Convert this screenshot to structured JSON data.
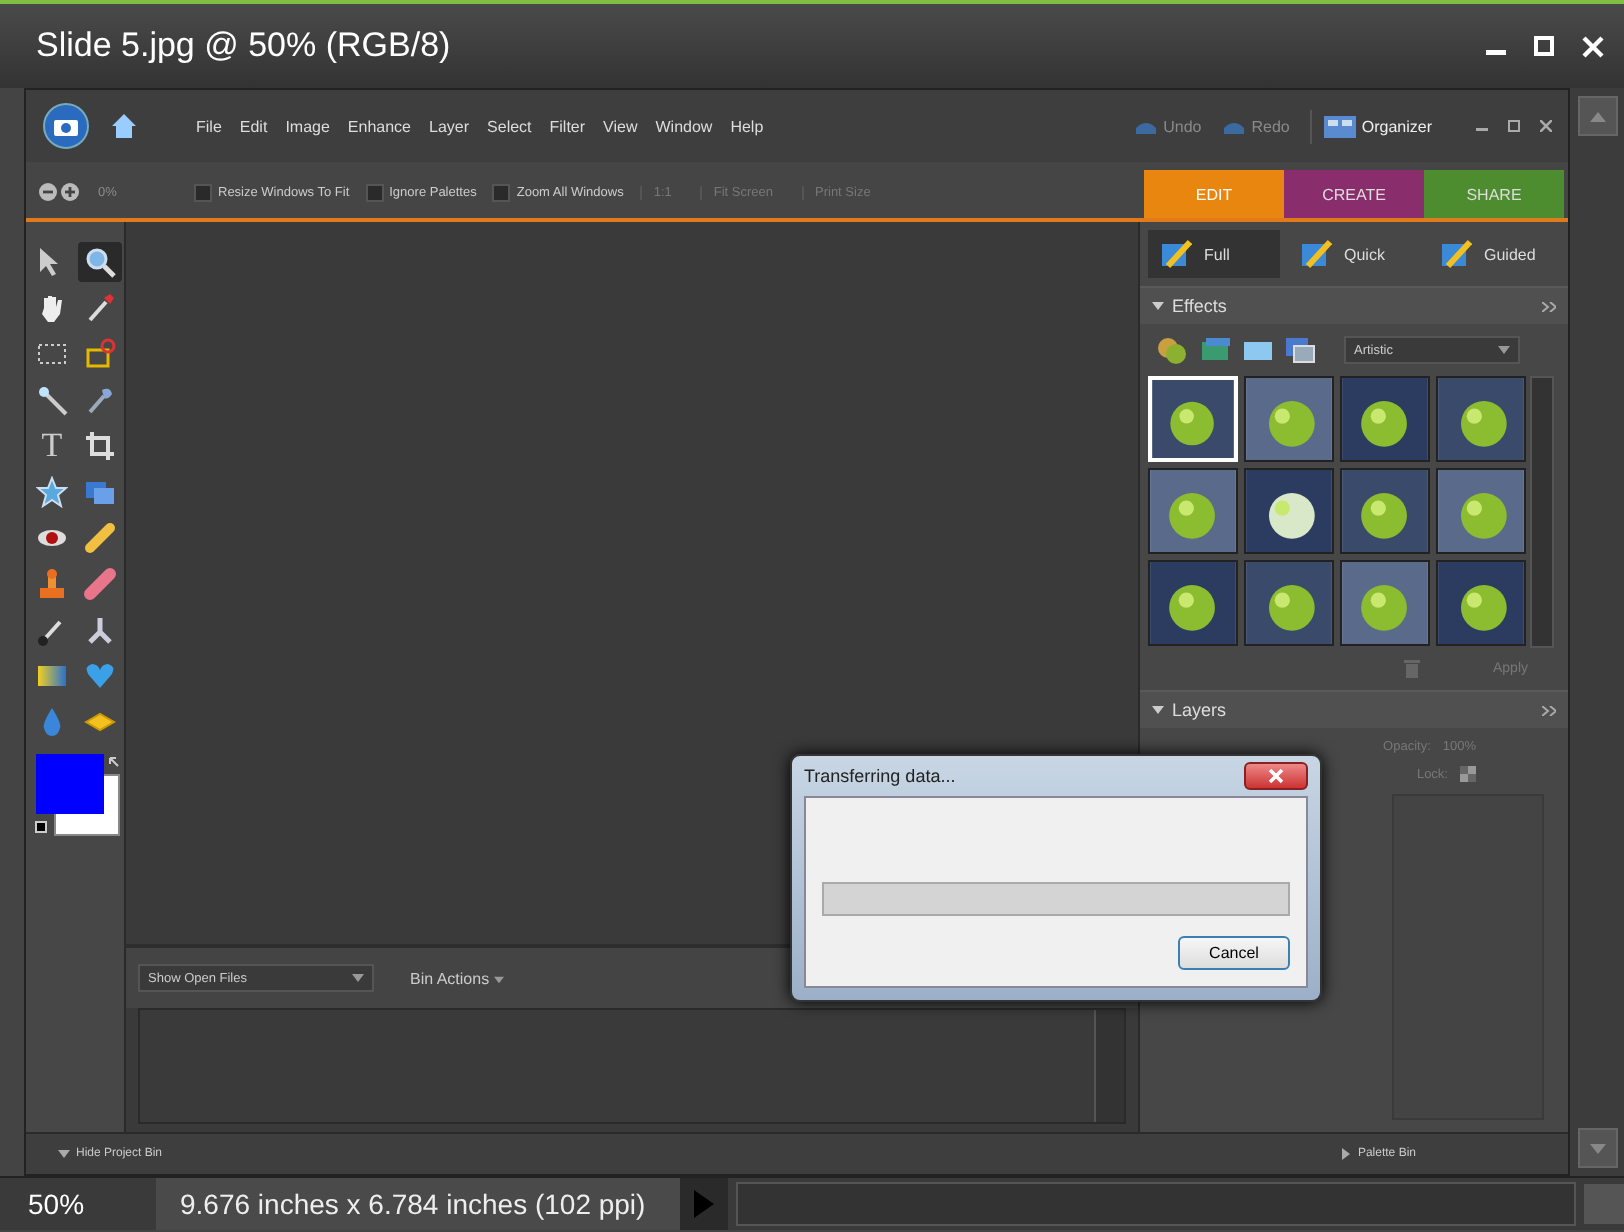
{
  "window": {
    "title": "Slide 5.jpg @ 50% (RGB/8)"
  },
  "app": {
    "menu": [
      "File",
      "Edit",
      "Image",
      "Enhance",
      "Layer",
      "Select",
      "Filter",
      "View",
      "Window",
      "Help"
    ],
    "undo": "Undo",
    "redo": "Redo",
    "organizer": "Organizer",
    "options": {
      "zoom_value": "0%",
      "checkboxes": [
        {
          "label": "Resize Windows To Fit",
          "checked": false
        },
        {
          "label": "Ignore Palettes",
          "checked": false
        },
        {
          "label": "Zoom All Windows",
          "checked": false
        }
      ],
      "buttons": [
        "1:1",
        "Fit Screen",
        "Print Size"
      ]
    },
    "tabs": [
      {
        "label": "EDIT",
        "selected": true,
        "color": "#e9860f"
      },
      {
        "label": "CREATE",
        "selected": false,
        "color": "#8a2d6c"
      },
      {
        "label": "SHARE",
        "selected": false,
        "color": "#4e8c30"
      }
    ],
    "tools": [
      {
        "selected": false
      },
      {
        "selected": true
      },
      {
        "selected": false
      },
      {
        "selected": false
      },
      {
        "selected": false
      },
      {
        "selected": false
      },
      {
        "selected": false
      },
      {
        "selected": false
      },
      {
        "selected": false,
        "glyph": "T"
      },
      {
        "selected": false
      },
      {
        "selected": false
      },
      {
        "selected": false
      },
      {
        "selected": false
      },
      {
        "selected": false
      },
      {
        "selected": false
      },
      {
        "selected": false
      },
      {
        "selected": false
      },
      {
        "selected": false
      },
      {
        "selected": false
      },
      {
        "selected": false
      },
      {
        "selected": false
      },
      {
        "selected": false
      }
    ],
    "project_bin": {
      "dropdown": "Show Open Files",
      "actions": "Bin Actions",
      "toggle": "Hide Project Bin"
    },
    "palette_bin": {
      "label": "Palette Bin",
      "modes": [
        {
          "label": "Full",
          "selected": true
        },
        {
          "label": "Quick",
          "selected": false
        },
        {
          "label": "Guided",
          "selected": false
        }
      ],
      "effects": {
        "title": "Effects",
        "expanded": true,
        "category": "Artistic",
        "thumbnails": [
          {
            "selected": true
          },
          {
            "selected": false
          },
          {
            "selected": false
          },
          {
            "selected": false
          },
          {
            "selected": false
          },
          {
            "selected": false
          },
          {
            "selected": false
          },
          {
            "selected": false
          },
          {
            "selected": false
          },
          {
            "selected": false
          },
          {
            "selected": false
          },
          {
            "selected": false
          }
        ],
        "apply": "Apply"
      },
      "layers": {
        "title": "Layers",
        "expanded": true,
        "opacity_label": "Opacity:",
        "opacity": "100%",
        "lock": "Lock:"
      }
    }
  },
  "dialog": {
    "title": "Transferring data...",
    "progress": {
      "level": 0
    },
    "button": "Cancel"
  },
  "status_bar": {
    "zoom": "50%",
    "dimensions": "9.676 inches x 6.784 inches (102 ppi)"
  }
}
